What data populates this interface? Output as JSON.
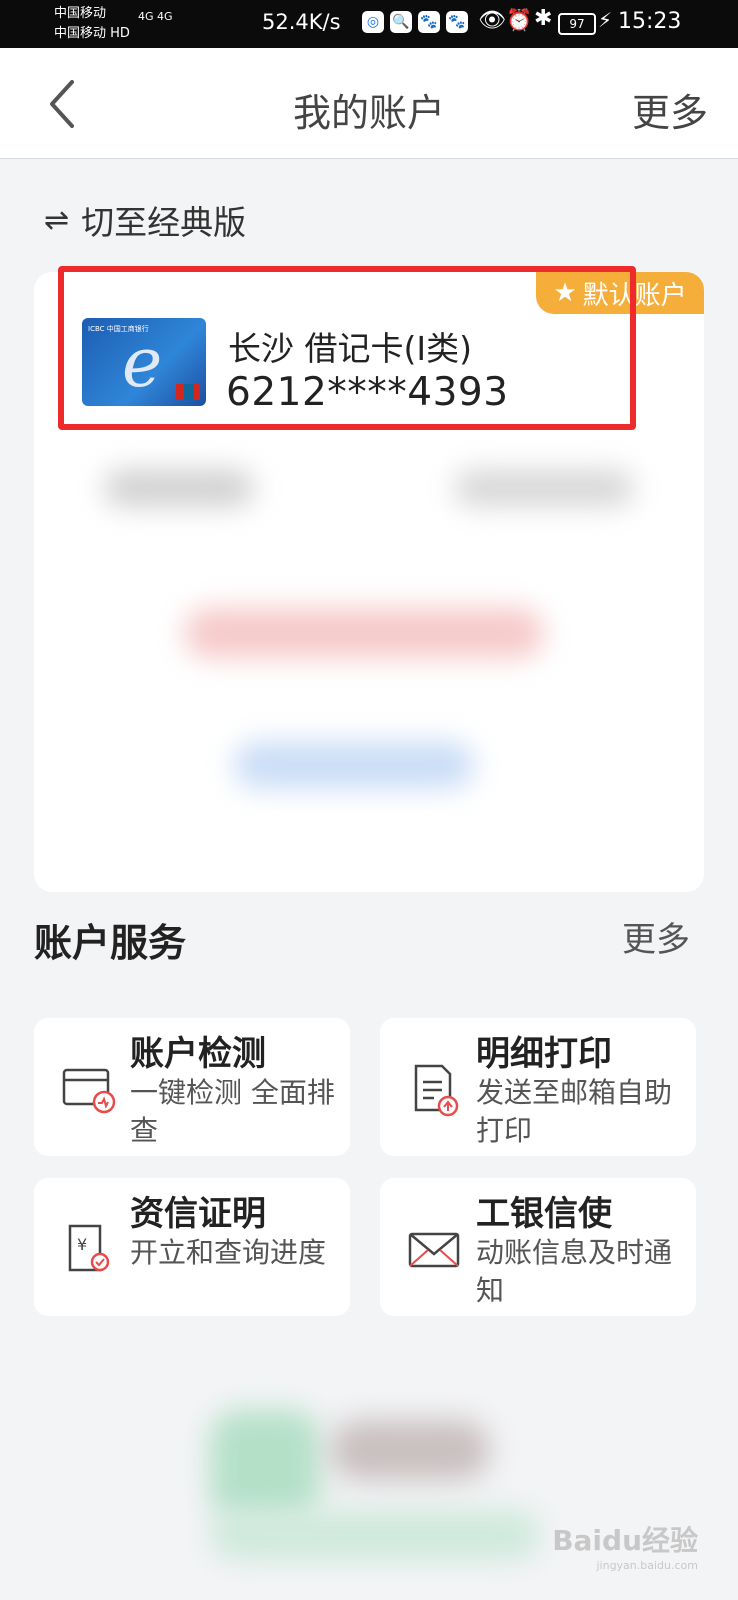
{
  "status_bar": {
    "carrier1": "中国移动",
    "carrier2": "中国移动 HD",
    "signal": "4G 4G",
    "net_speed": "52.4K/s",
    "battery": "97",
    "time": "15:23"
  },
  "nav": {
    "title": "我的账户",
    "more": "更多"
  },
  "switch_classic": "切至经典版",
  "account_card": {
    "default_badge": "默认账户",
    "name": "长沙 借记卡(I类)",
    "number": "6212****4393",
    "card_logo_text": "ICBC 中国工商银行"
  },
  "services": {
    "title": "账户服务",
    "more": "更多",
    "items": [
      {
        "name": "账户检测",
        "desc": "一键检测 全面排查",
        "icon": "account-check-icon"
      },
      {
        "name": "明细打印",
        "desc": "发送至邮箱自助打印",
        "icon": "print-detail-icon"
      },
      {
        "name": "资信证明",
        "desc": "开立和查询进度",
        "icon": "credit-certificate-icon"
      },
      {
        "name": "工银信使",
        "desc": "动账信息及时通知",
        "icon": "mail-icon"
      }
    ]
  },
  "watermark": {
    "brand": "Baidu经验",
    "sub": "jingyan.baidu.com"
  }
}
